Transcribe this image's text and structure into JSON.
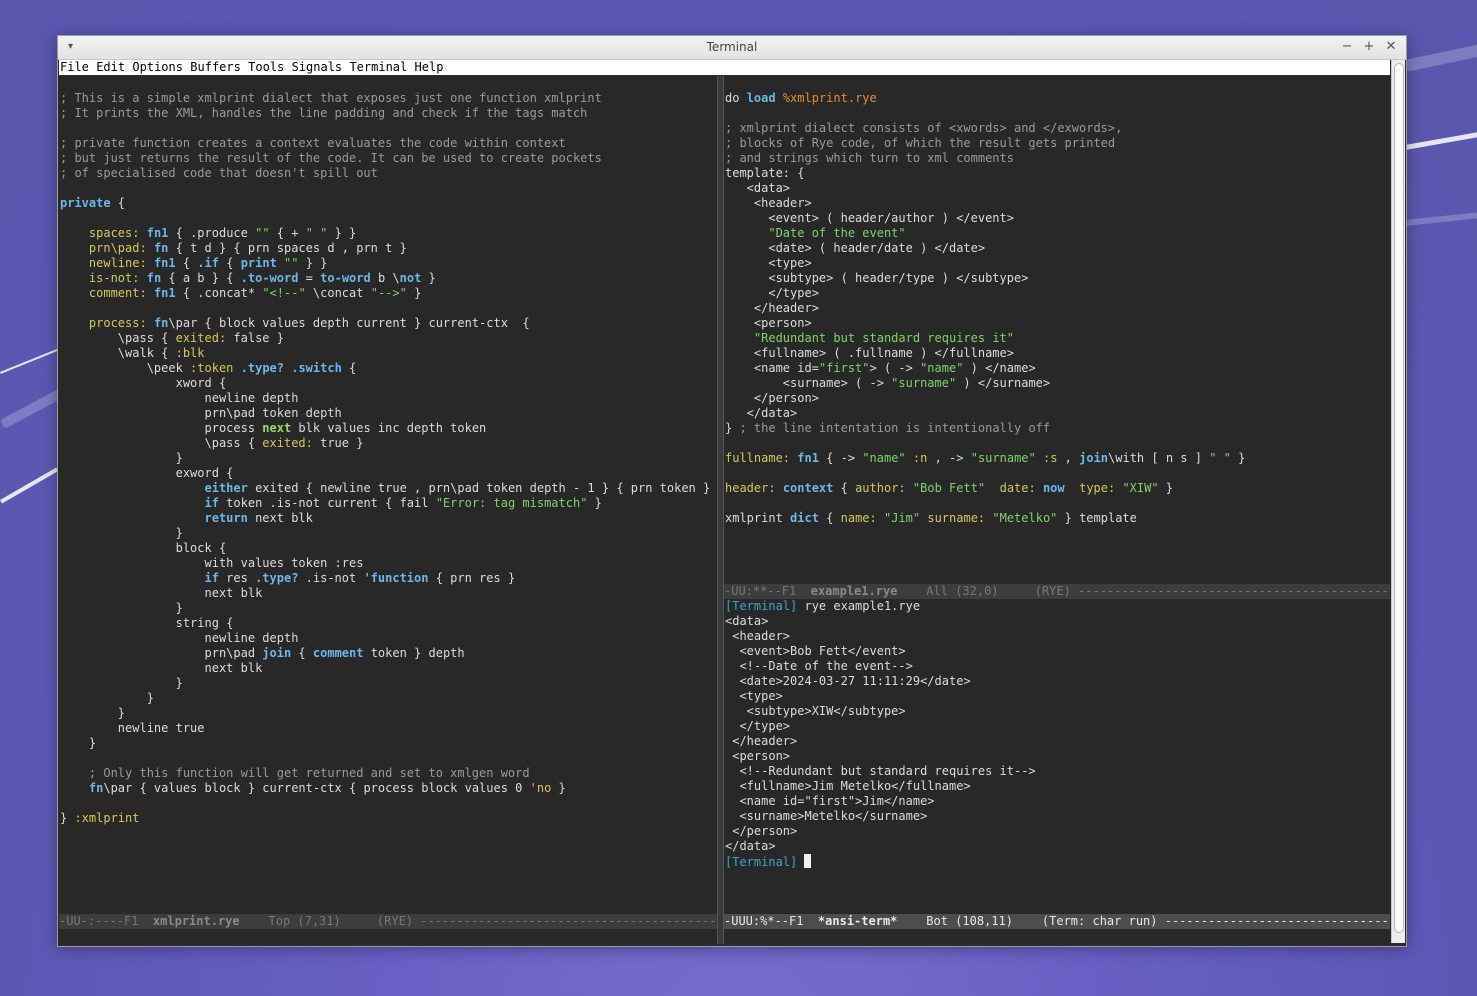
{
  "window": {
    "title": "Terminal",
    "menu_icon": "▾",
    "buttons": {
      "minimize": "−",
      "maximize": "+",
      "close": "✕"
    }
  },
  "menu": [
    "File",
    "Edit",
    "Options",
    "Buffers",
    "Tools",
    "Signals",
    "Terminal",
    "Help"
  ],
  "left_buffer": {
    "lines": [
      [],
      [
        [
          "; This is a simple xmlprint dialect that exposes just one function xmlprint",
          "cm"
        ]
      ],
      [
        [
          "; It prints the XML, handles the line padding and check if the tags match",
          "cm"
        ]
      ],
      [],
      [
        [
          "; private function creates a context evaluates the code within context",
          "cm"
        ]
      ],
      [
        [
          "; but just returns the result of the code. It can be used to create pockets",
          "cm"
        ]
      ],
      [
        [
          "; of specialised code that doesn't spill out",
          "cm"
        ]
      ],
      [],
      [
        [
          "private",
          "kw"
        ],
        [
          " {",
          ""
        ]
      ],
      [],
      [
        [
          "    ",
          ""
        ],
        [
          "spaces:",
          "fn"
        ],
        [
          " ",
          ""
        ],
        [
          "fn1",
          "kw"
        ],
        [
          " { .produce ",
          ""
        ],
        [
          "\"\"",
          "st"
        ],
        [
          " { + ",
          ""
        ],
        [
          "\" \"",
          "st"
        ],
        [
          " } }",
          ""
        ]
      ],
      [
        [
          "    ",
          ""
        ],
        [
          "prn\\pad:",
          "fn"
        ],
        [
          " ",
          ""
        ],
        [
          "fn",
          "kw"
        ],
        [
          " { t d } { prn spaces d , prn t }",
          ""
        ]
      ],
      [
        [
          "    ",
          ""
        ],
        [
          "newline:",
          "fn"
        ],
        [
          " ",
          ""
        ],
        [
          "fn1",
          "kw"
        ],
        [
          " { ",
          ""
        ],
        [
          ".if",
          "kw"
        ],
        [
          " { ",
          ""
        ],
        [
          "print",
          "kw"
        ],
        [
          " ",
          ""
        ],
        [
          "\"\"",
          "st"
        ],
        [
          " } }",
          ""
        ]
      ],
      [
        [
          "    ",
          ""
        ],
        [
          "is-not:",
          "fn"
        ],
        [
          " ",
          ""
        ],
        [
          "fn",
          "kw"
        ],
        [
          " { a b } { ",
          ""
        ],
        [
          ".to-word",
          "kw"
        ],
        [
          " = ",
          ""
        ],
        [
          "to-word",
          "kw"
        ],
        [
          " b \\",
          ""
        ],
        [
          "not",
          "kw"
        ],
        [
          " }",
          ""
        ]
      ],
      [
        [
          "    ",
          ""
        ],
        [
          "comment:",
          "fn"
        ],
        [
          " ",
          ""
        ],
        [
          "fn1",
          "kw"
        ],
        [
          " { .concat* ",
          ""
        ],
        [
          "\"<!--\"",
          "st"
        ],
        [
          " \\concat ",
          ""
        ],
        [
          "\"-->\"",
          "st"
        ],
        [
          " }",
          ""
        ]
      ],
      [],
      [
        [
          "    ",
          ""
        ],
        [
          "process:",
          "fn"
        ],
        [
          " ",
          ""
        ],
        [
          "fn",
          "kw"
        ],
        [
          "\\par { block values depth current } current-ctx  {",
          ""
        ]
      ],
      [
        [
          "        \\pass { ",
          ""
        ],
        [
          "exited:",
          "fn"
        ],
        [
          " false }",
          ""
        ]
      ],
      [
        [
          "        \\walk { ",
          ""
        ],
        [
          ":blk",
          "fn"
        ]
      ],
      [
        [
          "            \\peek ",
          ""
        ],
        [
          ":token",
          "fn"
        ],
        [
          " ",
          ""
        ],
        [
          ".type?",
          "kw"
        ],
        [
          " ",
          ""
        ],
        [
          ".switch",
          "kw"
        ],
        [
          " {",
          ""
        ]
      ],
      [
        [
          "                xword {",
          ""
        ]
      ],
      [
        [
          "                    newline depth",
          ""
        ]
      ],
      [
        [
          "                    prn\\pad token depth",
          ""
        ]
      ],
      [
        [
          "                    process ",
          ""
        ],
        [
          "next",
          "gr"
        ],
        [
          " blk values inc depth token",
          ""
        ]
      ],
      [
        [
          "                    \\pass { ",
          ""
        ],
        [
          "exited:",
          "fn"
        ],
        [
          " true }",
          ""
        ]
      ],
      [
        [
          "                }",
          ""
        ]
      ],
      [
        [
          "                exword {",
          ""
        ]
      ],
      [
        [
          "                    ",
          ""
        ],
        [
          "either",
          "kw"
        ],
        [
          " exited { newline true , prn\\pad token depth - 1 } { prn token }",
          ""
        ]
      ],
      [
        [
          "                    ",
          ""
        ],
        [
          "if",
          "kw"
        ],
        [
          " token .is-not current { fail ",
          ""
        ],
        [
          "\"Error: tag mismatch\"",
          "st"
        ],
        [
          " }",
          ""
        ]
      ],
      [
        [
          "                    ",
          ""
        ],
        [
          "return",
          "kw"
        ],
        [
          " next blk",
          ""
        ]
      ],
      [
        [
          "                }",
          ""
        ]
      ],
      [
        [
          "                block {",
          ""
        ]
      ],
      [
        [
          "                    with values token :res",
          ""
        ]
      ],
      [
        [
          "                    ",
          ""
        ],
        [
          "if",
          "kw"
        ],
        [
          " res ",
          ""
        ],
        [
          ".type?",
          "kw"
        ],
        [
          " .is-not '",
          ""
        ],
        [
          "function",
          "kw"
        ],
        [
          " { prn res }",
          ""
        ]
      ],
      [
        [
          "                    next blk",
          ""
        ]
      ],
      [
        [
          "                }",
          ""
        ]
      ],
      [
        [
          "                string {",
          ""
        ]
      ],
      [
        [
          "                    newline depth",
          ""
        ]
      ],
      [
        [
          "                    prn\\pad ",
          ""
        ],
        [
          "join",
          "kw"
        ],
        [
          " { ",
          ""
        ],
        [
          "comment",
          "kw"
        ],
        [
          " token } depth",
          ""
        ]
      ],
      [
        [
          "                    next blk",
          ""
        ]
      ],
      [
        [
          "                }",
          ""
        ]
      ],
      [
        [
          "            }",
          ""
        ]
      ],
      [
        [
          "        }",
          ""
        ]
      ],
      [
        [
          "        newline true",
          ""
        ]
      ],
      [
        [
          "    }",
          ""
        ]
      ],
      [],
      [
        [
          "    ",
          ""
        ],
        [
          "; Only this function will get returned and set to xmlgen word",
          "cm"
        ]
      ],
      [
        [
          "    ",
          ""
        ],
        [
          "fn",
          "kw"
        ],
        [
          "\\par { values block } current-ctx { process block values 0 ",
          ""
        ],
        [
          "'no",
          "fn"
        ],
        [
          " }",
          ""
        ]
      ],
      [],
      [
        [
          "} ",
          ""
        ],
        [
          ":xmlprint",
          "fn"
        ]
      ]
    ],
    "modeline": {
      "status": "-UU-:----F1  ",
      "buffer": "xmlprint.rye",
      "position": "    Top (7,31)     (RYE) ",
      "fill": "------------------------------------------------------------"
    }
  },
  "right_top_buffer": {
    "lines": [
      [],
      [
        [
          "do ",
          ""
        ],
        [
          "load",
          "kw"
        ],
        [
          " ",
          ""
        ],
        [
          "%xmlprint.rye",
          "or"
        ]
      ],
      [],
      [
        [
          "; xmlprint dialect consists of <xwords> and </exwords>,",
          "cm"
        ]
      ],
      [
        [
          "; blocks of Rye code, of which the result gets printed",
          "cm"
        ]
      ],
      [
        [
          "; and strings which turn to xml comments",
          "cm"
        ]
      ],
      [
        [
          "template: {",
          ""
        ]
      ],
      [
        [
          "   <data>",
          ""
        ]
      ],
      [
        [
          "    <header>",
          ""
        ]
      ],
      [
        [
          "      <event> ( header/author ) </event>",
          ""
        ]
      ],
      [
        [
          "      ",
          ""
        ],
        [
          "\"Date of the event\"",
          "st"
        ]
      ],
      [
        [
          "      <date> ( header/date ) </date>",
          ""
        ]
      ],
      [
        [
          "      <type>",
          ""
        ]
      ],
      [
        [
          "      <subtype> ( header/type ) </subtype>",
          ""
        ]
      ],
      [
        [
          "      </type>",
          ""
        ]
      ],
      [
        [
          "    </header>",
          ""
        ]
      ],
      [
        [
          "    <person>",
          ""
        ]
      ],
      [
        [
          "    ",
          ""
        ],
        [
          "\"Redundant but standard requires it\"",
          "st"
        ]
      ],
      [
        [
          "    <fullname> ( .fullname ) </fullname>",
          ""
        ]
      ],
      [
        [
          "    <name id=",
          ""
        ],
        [
          "\"first\"",
          "st"
        ],
        [
          "> ( -> ",
          ""
        ],
        [
          "\"name\"",
          "st"
        ],
        [
          " ) </name>",
          ""
        ]
      ],
      [
        [
          "        <surname> ( -> ",
          ""
        ],
        [
          "\"surname\"",
          "st"
        ],
        [
          " ) </surname>",
          ""
        ]
      ],
      [
        [
          "    </person>",
          ""
        ]
      ],
      [
        [
          "   </data>",
          ""
        ]
      ],
      [
        [
          "} ",
          ""
        ],
        [
          "; the line intentation is intentionally off",
          "cm"
        ]
      ],
      [],
      [
        [
          "fullname:",
          "fn"
        ],
        [
          " ",
          ""
        ],
        [
          "fn1",
          "kw"
        ],
        [
          " { -> ",
          ""
        ],
        [
          "\"name\"",
          "st"
        ],
        [
          " ",
          ""
        ],
        [
          ":n",
          "fn"
        ],
        [
          " , -> ",
          ""
        ],
        [
          "\"surname\"",
          "st"
        ],
        [
          " ",
          ""
        ],
        [
          ":s",
          "fn"
        ],
        [
          " , ",
          ""
        ],
        [
          "join",
          "kw"
        ],
        [
          "\\with [ n s ] ",
          ""
        ],
        [
          "\" \"",
          "st"
        ],
        [
          " }",
          ""
        ]
      ],
      [],
      [
        [
          "header:",
          "fn"
        ],
        [
          " ",
          ""
        ],
        [
          "context",
          "kw"
        ],
        [
          " { ",
          ""
        ],
        [
          "author:",
          "fn"
        ],
        [
          " ",
          ""
        ],
        [
          "\"Bob Fett\"",
          "st"
        ],
        [
          "  ",
          ""
        ],
        [
          "date:",
          "fn"
        ],
        [
          " ",
          ""
        ],
        [
          "now",
          "kw"
        ],
        [
          "  ",
          ""
        ],
        [
          "type:",
          "fn"
        ],
        [
          " ",
          ""
        ],
        [
          "\"XIW\"",
          "st"
        ],
        [
          " }",
          ""
        ]
      ],
      [],
      [
        [
          "xmlprint ",
          ""
        ],
        [
          "dict",
          "kw"
        ],
        [
          " { ",
          ""
        ],
        [
          "name:",
          "fn"
        ],
        [
          " ",
          ""
        ],
        [
          "\"Jim\"",
          "st"
        ],
        [
          " ",
          ""
        ],
        [
          "surname:",
          "fn"
        ],
        [
          " ",
          ""
        ],
        [
          "\"Metelko\"",
          "st"
        ],
        [
          " } template",
          ""
        ]
      ]
    ],
    "modeline": {
      "status": "-UU:**--F1  ",
      "buffer": "example1.rye",
      "position": "    All (32,0)     (RYE) ",
      "fill": "--------------------------------------------------------------"
    }
  },
  "terminal": {
    "lines": [
      [
        [
          "[Terminal]",
          "pr"
        ],
        [
          " rye example1.rye",
          ""
        ]
      ],
      [
        [
          "<data>",
          ""
        ]
      ],
      [
        [
          " <header>",
          ""
        ]
      ],
      [
        [
          "  <event>Bob Fett</event>",
          ""
        ]
      ],
      [
        [
          "  <!--Date of the event-->",
          ""
        ]
      ],
      [
        [
          "  <date>2024-03-27 11:11:29</date>",
          ""
        ]
      ],
      [
        [
          "  <type>",
          ""
        ]
      ],
      [
        [
          "   <subtype>XIW</subtype>",
          ""
        ]
      ],
      [
        [
          "  </type>",
          ""
        ]
      ],
      [
        [
          " </header>",
          ""
        ]
      ],
      [
        [
          " <person>",
          ""
        ]
      ],
      [
        [
          "  <!--Redundant but standard requires it-->",
          ""
        ]
      ],
      [
        [
          "  <fullname>Jim Metelko</fullname>",
          ""
        ]
      ],
      [
        [
          "  <name id=\"first\">Jim</name>",
          ""
        ]
      ],
      [
        [
          "  <surname>Metelko</surname>",
          ""
        ]
      ],
      [
        [
          " </person>",
          ""
        ]
      ],
      [
        [
          "</data>",
          ""
        ]
      ]
    ],
    "prompt": "[Terminal]",
    "modeline": {
      "status": "-UUU:%*--F1  ",
      "buffer": "*ansi-term*",
      "position": "    Bot (108,11)    (Term: char run) ",
      "fill": "------------------------------------------------"
    }
  }
}
